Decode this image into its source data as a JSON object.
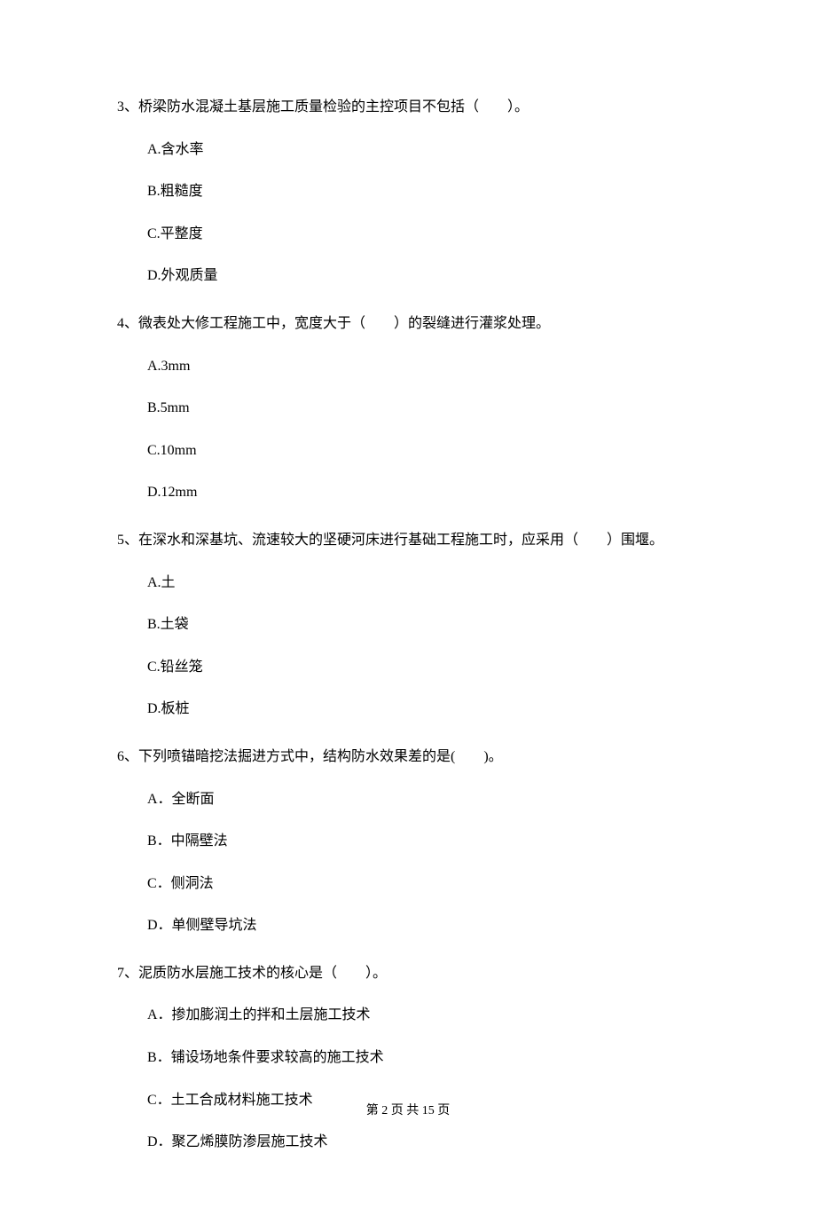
{
  "questions": [
    {
      "stem": "3、桥梁防水混凝土基层施工质量检验的主控项目不包括（　　）。",
      "options": [
        "A.含水率",
        "B.粗糙度",
        "C.平整度",
        "D.外观质量"
      ]
    },
    {
      "stem": "4、微表处大修工程施工中，宽度大于（　　）的裂缝进行灌浆处理。",
      "options": [
        "A.3mm",
        "B.5mm",
        "C.10mm",
        "D.12mm"
      ]
    },
    {
      "stem": "5、在深水和深基坑、流速较大的坚硬河床进行基础工程施工时，应采用（　　）围堰。",
      "options": [
        "A.土",
        "B.土袋",
        "C.铅丝笼",
        "D.板桩"
      ]
    },
    {
      "stem": "6、下列喷锚暗挖法掘进方式中，结构防水效果差的是(　　)。",
      "options": [
        "A．全断面",
        "B．中隔壁法",
        "C．侧洞法",
        "D．单侧壁导坑法"
      ]
    },
    {
      "stem": "7、泥质防水层施工技术的核心是（　　）。",
      "options": [
        "A．掺加膨润土的拌和土层施工技术",
        "B．铺设场地条件要求较高的施工技术",
        "C．土工合成材料施工技术",
        "D．聚乙烯膜防渗层施工技术"
      ]
    }
  ],
  "footer": "第 2 页 共 15 页"
}
